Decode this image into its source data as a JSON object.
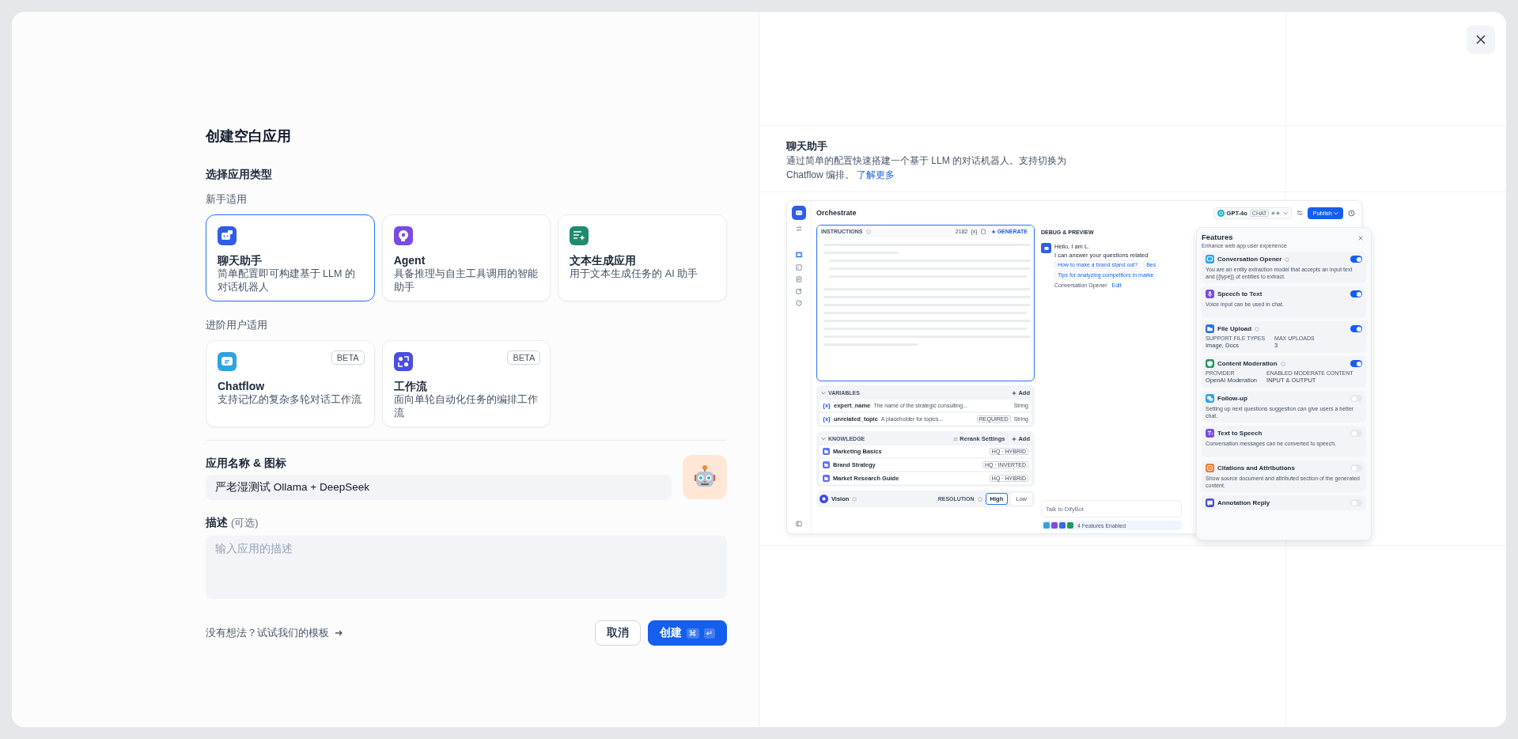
{
  "title": "创建空白应用",
  "app_type": {
    "heading": "选择应用类型",
    "groups": [
      {
        "label": "新手适用",
        "cards": [
          {
            "kind": "chat",
            "color": "#2f5ee6",
            "name": "聊天助手",
            "description": "简单配置即可构建基于 LLM 的对话机器人",
            "selected": true
          },
          {
            "kind": "agent",
            "color": "#7a4be0",
            "name": "Agent",
            "description": "具备推理与自主工具调用的智能助手",
            "selected": false
          },
          {
            "kind": "text",
            "color": "#1f8a6f",
            "name": "文本生成应用",
            "description": "用于文本生成任务的 AI 助手",
            "selected": false
          }
        ]
      },
      {
        "label": "进阶用户适用",
        "cards": [
          {
            "kind": "chatflow",
            "color": "#2ea3e0",
            "name": "Chatflow",
            "description": "支持记忆的复杂多轮对话工作流",
            "badge": "BETA",
            "selected": false
          },
          {
            "kind": "workflow",
            "color": "#4b4fe0",
            "name": "工作流",
            "description": "面向单轮自动化任务的编排工作流",
            "badge": "BETA",
            "selected": false
          }
        ]
      }
    ]
  },
  "name_field": {
    "label": "应用名称 & 图标",
    "value": "严老湿测试 Ollama + DeepSeek"
  },
  "description_field": {
    "label": "描述",
    "optional": "(可选)",
    "placeholder": "输入应用的描述"
  },
  "template_link": "没有想法？试试我们的模板",
  "buttons": [
    {
      "kind": "secondary",
      "label": "取消"
    },
    {
      "kind": "primary",
      "label": "创建",
      "keys": [
        "⌘",
        "↵"
      ]
    }
  ],
  "preview": {
    "title": "聊天助手",
    "description": "通过简单的配置快速搭建一个基于 LLM 的对话机器人。支持切换为 Chatflow 编排。",
    "link": "了解更多",
    "screenshot": {
      "page_title": "Orchestrate",
      "model": {
        "name": "GPT-4o",
        "mode": "CHAT"
      },
      "publish": "Publish",
      "instructions": {
        "label": "INSTRUCTIONS",
        "count": "2182",
        "variable_button": "{x}",
        "generate": "GENERATE"
      },
      "variables": {
        "heading": "VARIABLES",
        "add": "Add",
        "items": [
          {
            "marker": "{x}",
            "name": "expert_name",
            "description": "The name of the strategic consulting...",
            "type": "String"
          },
          {
            "marker": "{x}",
            "name": "unrelated_topic",
            "description": "A placeholder for topics...",
            "required": "REQUIRED",
            "type": "String"
          }
        ]
      },
      "knowledge": {
        "heading": "KNOWLEDGE",
        "rerank": "Rerank Settings",
        "add": "Add",
        "items": [
          {
            "name": "Marketing Basics",
            "tag": "HQ · HYBRID"
          },
          {
            "name": "Brand Strategy",
            "tag": "HQ · INVERTED"
          },
          {
            "name": "Market Research Guide",
            "tag": "HQ · HYBRID"
          }
        ]
      },
      "vision": {
        "label": "Vision",
        "resolution_label": "RESOLUTION",
        "options": [
          {
            "label": "High",
            "selected": true
          },
          {
            "label": "Low",
            "selected": false
          }
        ]
      },
      "debug": {
        "heading": "DEBUG & PREVIEW",
        "greeting": [
          "Hello, I am L.",
          "I can answer your questions related"
        ],
        "suggestions": [
          [
            "How to make a brand stand out?",
            "Bes"
          ],
          [
            "Tips for analyzing competitors in marke"
          ]
        ],
        "opener_label": "Conversation Opener",
        "edit": "Edit",
        "input_placeholder": "Talk to DifyBot",
        "features_enabled": "4 Features Enabled"
      },
      "features": {
        "title": "Features",
        "subtitle": "Enhance web app user experience",
        "items": [
          {
            "kind": "opener",
            "color": "#2ea3e0",
            "name": "Conversation Opener",
            "help": true,
            "on": true,
            "description": "You are an entity extraction model that accepts an input text and {{type}} of entities to extract."
          },
          {
            "kind": "mic",
            "color": "#7a4be0",
            "name": "Speech to Text",
            "help": false,
            "on": true,
            "description": "Voice input can be used in chat."
          },
          {
            "kind": "upload",
            "color": "#2f6ee6",
            "name": "File Upload",
            "help": true,
            "on": true,
            "fields": [
              {
                "label": "SUPPORT FILE TYPES",
                "value": "Image, Docs"
              },
              {
                "label": "MAX UPLOADS",
                "value": "3"
              }
            ]
          },
          {
            "kind": "moderation",
            "color": "#1f9a5f",
            "name": "Content Moderation",
            "help": true,
            "on": true,
            "fields": [
              {
                "label": "PROVIDER",
                "value": "OpenAI Moderation"
              },
              {
                "label": "ENABLED MODERATE CONTENT",
                "value": "INPUT & OUTPUT"
              }
            ]
          },
          {
            "kind": "followup",
            "color": "#2ea3e0",
            "name": "Follow-up",
            "help": false,
            "on": false,
            "description": "Setting up next questions suggestion can give users a better chat."
          },
          {
            "kind": "tts",
            "color": "#7a4be0",
            "name": "Text to Speech",
            "help": false,
            "on": false,
            "description": "Conversation messages can be converted to speech."
          },
          {
            "kind": "citation",
            "color": "#f07a2a",
            "name": "Citations and Attributions",
            "help": false,
            "on": false,
            "description": "Show source document and attributed section of the generated content."
          },
          {
            "kind": "annotation",
            "color": "#4b4fe0",
            "name": "Annotation Reply",
            "help": false,
            "on": false
          }
        ]
      }
    }
  }
}
